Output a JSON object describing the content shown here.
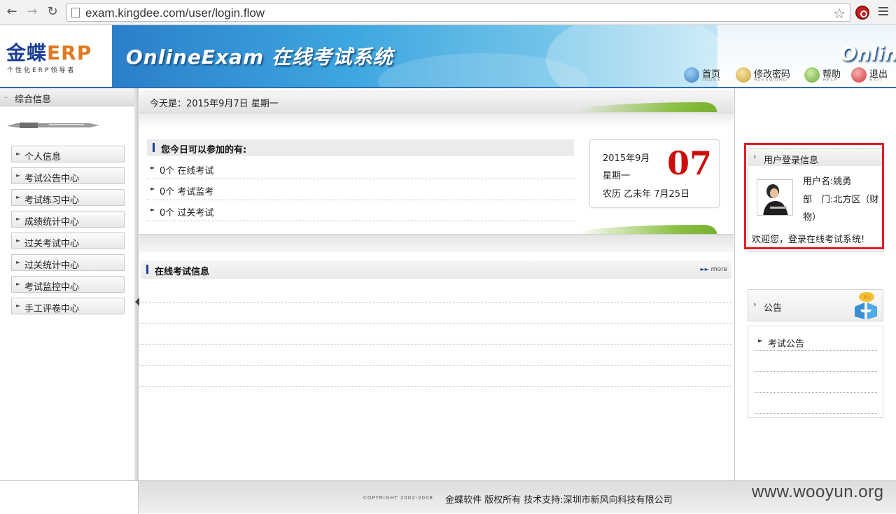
{
  "browser": {
    "url": "exam.kingdee.com/user/login.flow"
  },
  "banner": {
    "logo": "金蝶ERP",
    "logo_cn": "金蝶",
    "logo_erp": "ERP",
    "logo_sub": "个性化ERP领导者",
    "title": "OnlineExam 在线考试系统",
    "title_right_clip": "Online",
    "nav": [
      {
        "label": "首页",
        "sub": "INDEX",
        "icon": "home-icon",
        "color": "#3a7cc6"
      },
      {
        "label": "修改密码",
        "sub": "PASSWORD",
        "icon": "lock-icon",
        "color": "#c9a23a"
      },
      {
        "label": "帮助",
        "sub": "HELP",
        "icon": "help-icon",
        "color": "#6aa93a"
      },
      {
        "label": "退出",
        "sub": "EXIT",
        "icon": "exit-icon",
        "color": "#d4343a"
      }
    ]
  },
  "sidebar": {
    "header": "综合信息",
    "items": [
      {
        "label": "个人信息"
      },
      {
        "label": "考试公告中心"
      },
      {
        "label": "考试练习中心"
      },
      {
        "label": "成绩统计中心"
      },
      {
        "label": "过关考试中心"
      },
      {
        "label": "过关统计中心"
      },
      {
        "label": "考试监控中心"
      },
      {
        "label": "手工评卷中心"
      }
    ]
  },
  "main": {
    "today": "今天是：2015年9月7日 星期一",
    "available_title": "您今日可以参加的有:",
    "available": [
      {
        "label": "0个 在线考试"
      },
      {
        "label": "0个 考试监考"
      },
      {
        "label": "0个 过关考试"
      }
    ],
    "calendar": {
      "year_month": "2015年9月",
      "weekday": "星期一",
      "lunar": "农历 乙未年 7月25日",
      "day": "07"
    },
    "online_title": "在线考试信息",
    "more": "more"
  },
  "right": {
    "login_title": "用户登录信息",
    "username": "用户名:姚勇",
    "dept": "部　门:北方区（财物）",
    "welcome": "欢迎您，登录在线考试系统!",
    "notice_title": "公告",
    "notices": [
      {
        "label": "考试公告"
      }
    ]
  },
  "footer": {
    "copyright": "COPYRIGHT 2002-2008",
    "text": "金蝶软件 版权所有 技术支持:深圳市新风向科技有限公司",
    "watermark": "www.wooyun.org"
  },
  "colors": {
    "accent": "#1c3f95",
    "highlight_frame": "#e01d25",
    "calendar_day": "#cc0d0d"
  }
}
